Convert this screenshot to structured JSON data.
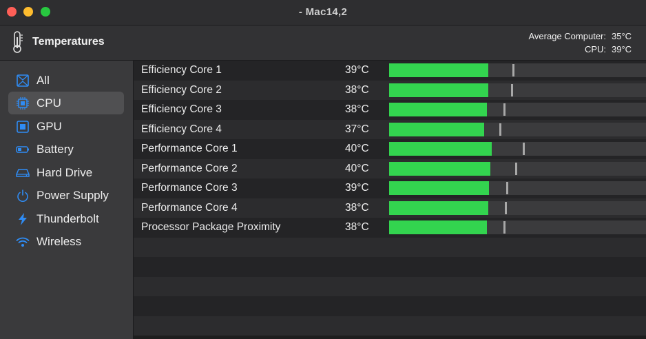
{
  "window": {
    "title": "- Mac14,2"
  },
  "header": {
    "title": "Temperatures",
    "summary": [
      {
        "label": "Average Computer:",
        "value": "35°C"
      },
      {
        "label": "CPU:",
        "value": "39°C"
      }
    ]
  },
  "sidebar": {
    "items": [
      {
        "label": "All",
        "icon": "all-icon"
      },
      {
        "label": "CPU",
        "icon": "cpu-icon",
        "selected": true
      },
      {
        "label": "GPU",
        "icon": "gpu-icon"
      },
      {
        "label": "Battery",
        "icon": "battery-icon"
      },
      {
        "label": "Hard Drive",
        "icon": "hard-drive-icon"
      },
      {
        "label": "Power Supply",
        "icon": "power-icon"
      },
      {
        "label": "Thunderbolt",
        "icon": "thunderbolt-icon"
      },
      {
        "label": "Wireless",
        "icon": "wireless-icon"
      }
    ]
  },
  "sensors": [
    {
      "name": "Efficiency Core 1",
      "temp": "39°C",
      "level": 0.385,
      "marker": 0.48
    },
    {
      "name": "Efficiency Core 2",
      "temp": "38°C",
      "level": 0.385,
      "marker": 0.475
    },
    {
      "name": "Efficiency Core 3",
      "temp": "38°C",
      "level": 0.38,
      "marker": 0.445
    },
    {
      "name": "Efficiency Core 4",
      "temp": "37°C",
      "level": 0.37,
      "marker": 0.43
    },
    {
      "name": "Performance Core 1",
      "temp": "40°C",
      "level": 0.4,
      "marker": 0.52
    },
    {
      "name": "Performance Core 2",
      "temp": "40°C",
      "level": 0.395,
      "marker": 0.49
    },
    {
      "name": "Performance Core 3",
      "temp": "39°C",
      "level": 0.39,
      "marker": 0.455
    },
    {
      "name": "Performance Core 4",
      "temp": "38°C",
      "level": 0.385,
      "marker": 0.45
    },
    {
      "name": "Processor Package Proximity",
      "temp": "38°C",
      "level": 0.38,
      "marker": 0.445
    }
  ],
  "empty_rows": 5,
  "colors": {
    "bar_fill": "#33d44f",
    "bar_track": "#3b3b3d",
    "marker": "#a8a8a8",
    "icon_blue": "#2f8cf5",
    "selection": "#505052"
  }
}
